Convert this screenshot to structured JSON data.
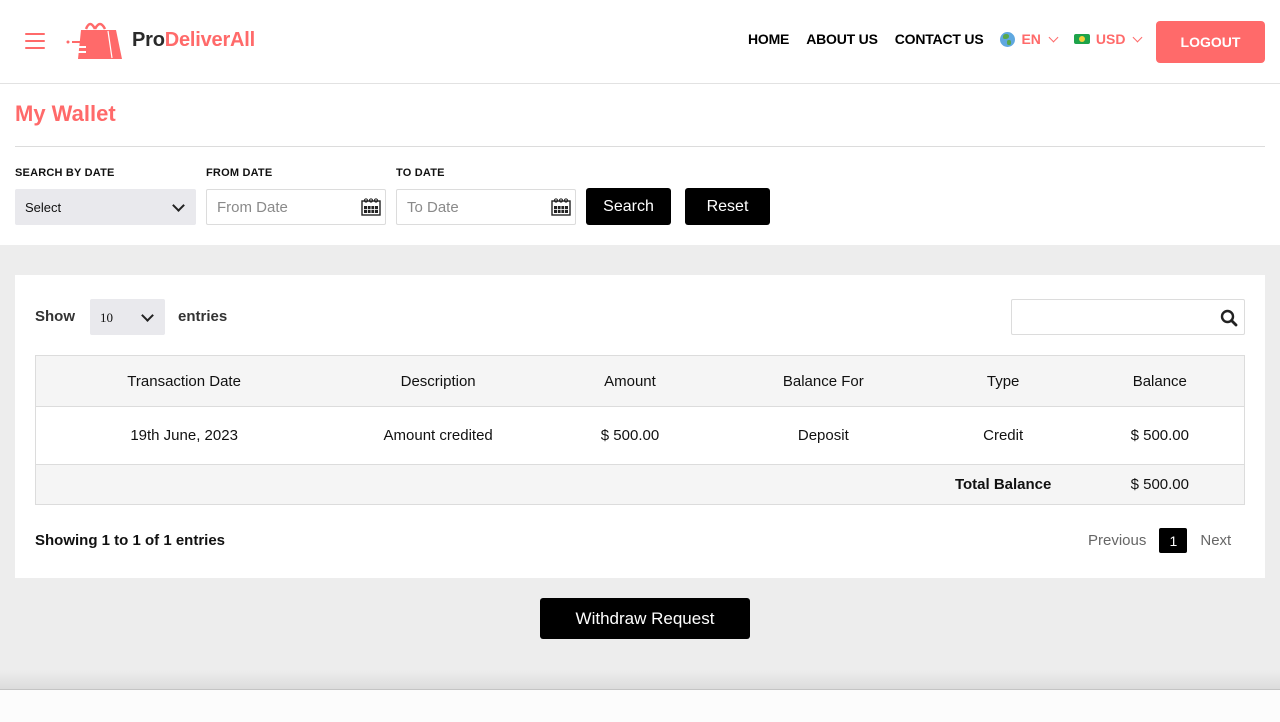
{
  "header": {
    "brand_prefix": "Pro",
    "brand_suffix": "DeliverAll",
    "nav": [
      "HOME",
      "ABOUT US",
      "CONTACT US"
    ],
    "language": "EN",
    "currency": "USD",
    "logout_label": "LOGOUT"
  },
  "page": {
    "title": "My Wallet"
  },
  "filters": {
    "search_by_date_label": "SEARCH BY DATE",
    "search_by_date_value": "Select",
    "from_date_label": "FROM DATE",
    "from_date_placeholder": "From Date",
    "from_date_value": "",
    "to_date_label": "TO DATE",
    "to_date_placeholder": "To Date",
    "to_date_value": "",
    "search_label": "Search",
    "reset_label": "Reset"
  },
  "table_controls": {
    "show_label": "Show",
    "entries_value": "10",
    "entries_label": "entries",
    "search_value": ""
  },
  "table": {
    "columns": [
      "Transaction Date",
      "Description",
      "Amount",
      "Balance For",
      "Type",
      "Balance"
    ],
    "rows": [
      [
        "19th June, 2023",
        "Amount credited",
        "$ 500.00",
        "Deposit",
        "Credit",
        "$ 500.00"
      ]
    ],
    "total_label": "Total Balance",
    "total_value": "$ 500.00"
  },
  "pagination": {
    "info": "Showing 1 to 1 of 1 entries",
    "previous": "Previous",
    "current_page": "1",
    "next": "Next"
  },
  "actions": {
    "withdraw_label": "Withdraw Request"
  },
  "colors": {
    "brand": "#ff6a6a",
    "dark_button": "#000000",
    "panel_bg": "#ededed"
  }
}
